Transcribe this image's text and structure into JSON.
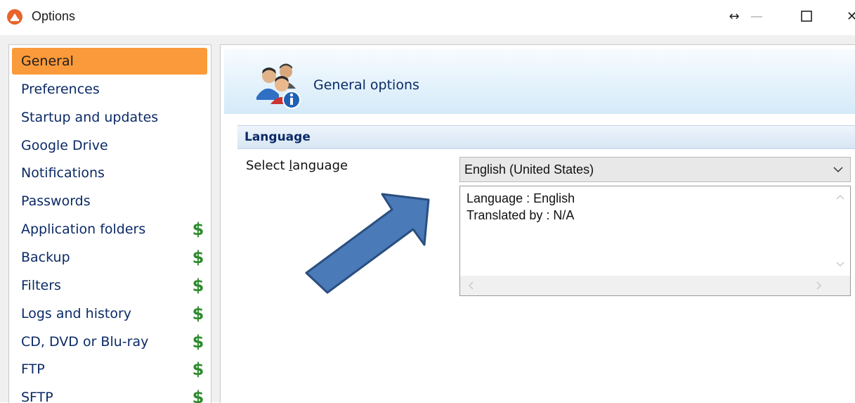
{
  "window": {
    "title": "Options",
    "controls": {
      "move": "↔",
      "minimize": "—",
      "maximize": "☐",
      "close": "✕"
    }
  },
  "sidebar": {
    "items": [
      {
        "label": "General",
        "active": true,
        "premium": false
      },
      {
        "label": "Preferences",
        "premium": false
      },
      {
        "label": "Startup and updates",
        "premium": false
      },
      {
        "label": "Google Drive",
        "premium": false
      },
      {
        "label": "Notifications",
        "premium": false
      },
      {
        "label": "Passwords",
        "premium": false
      },
      {
        "label": "Application folders",
        "premium": true
      },
      {
        "label": "Backup",
        "premium": true
      },
      {
        "label": "Filters",
        "premium": true
      },
      {
        "label": "Logs and history",
        "premium": true
      },
      {
        "label": "CD, DVD or Blu-ray",
        "premium": true
      },
      {
        "label": "FTP",
        "premium": true
      },
      {
        "label": "SFTP",
        "premium": true
      }
    ],
    "premium_symbol": "$"
  },
  "main": {
    "header_title": "General options",
    "section_title": "Language",
    "language_label_prefix": "Select ",
    "language_label_underlined": "l",
    "language_label_rest": "anguage",
    "language_value": "English (United States)",
    "info_line1": "Language : English",
    "info_line2": "Translated by : N/A"
  },
  "colors": {
    "active_item": "#fa9a3a",
    "nav_text": "#0b2a66",
    "premium_green": "#2e8b2e",
    "arrow_fill": "#4a7ab8",
    "app_icon": "#e8642c"
  },
  "icons": {
    "app": "app-logo-icon",
    "header": "users-info-icon",
    "dropdown": "chevron-down-icon"
  }
}
